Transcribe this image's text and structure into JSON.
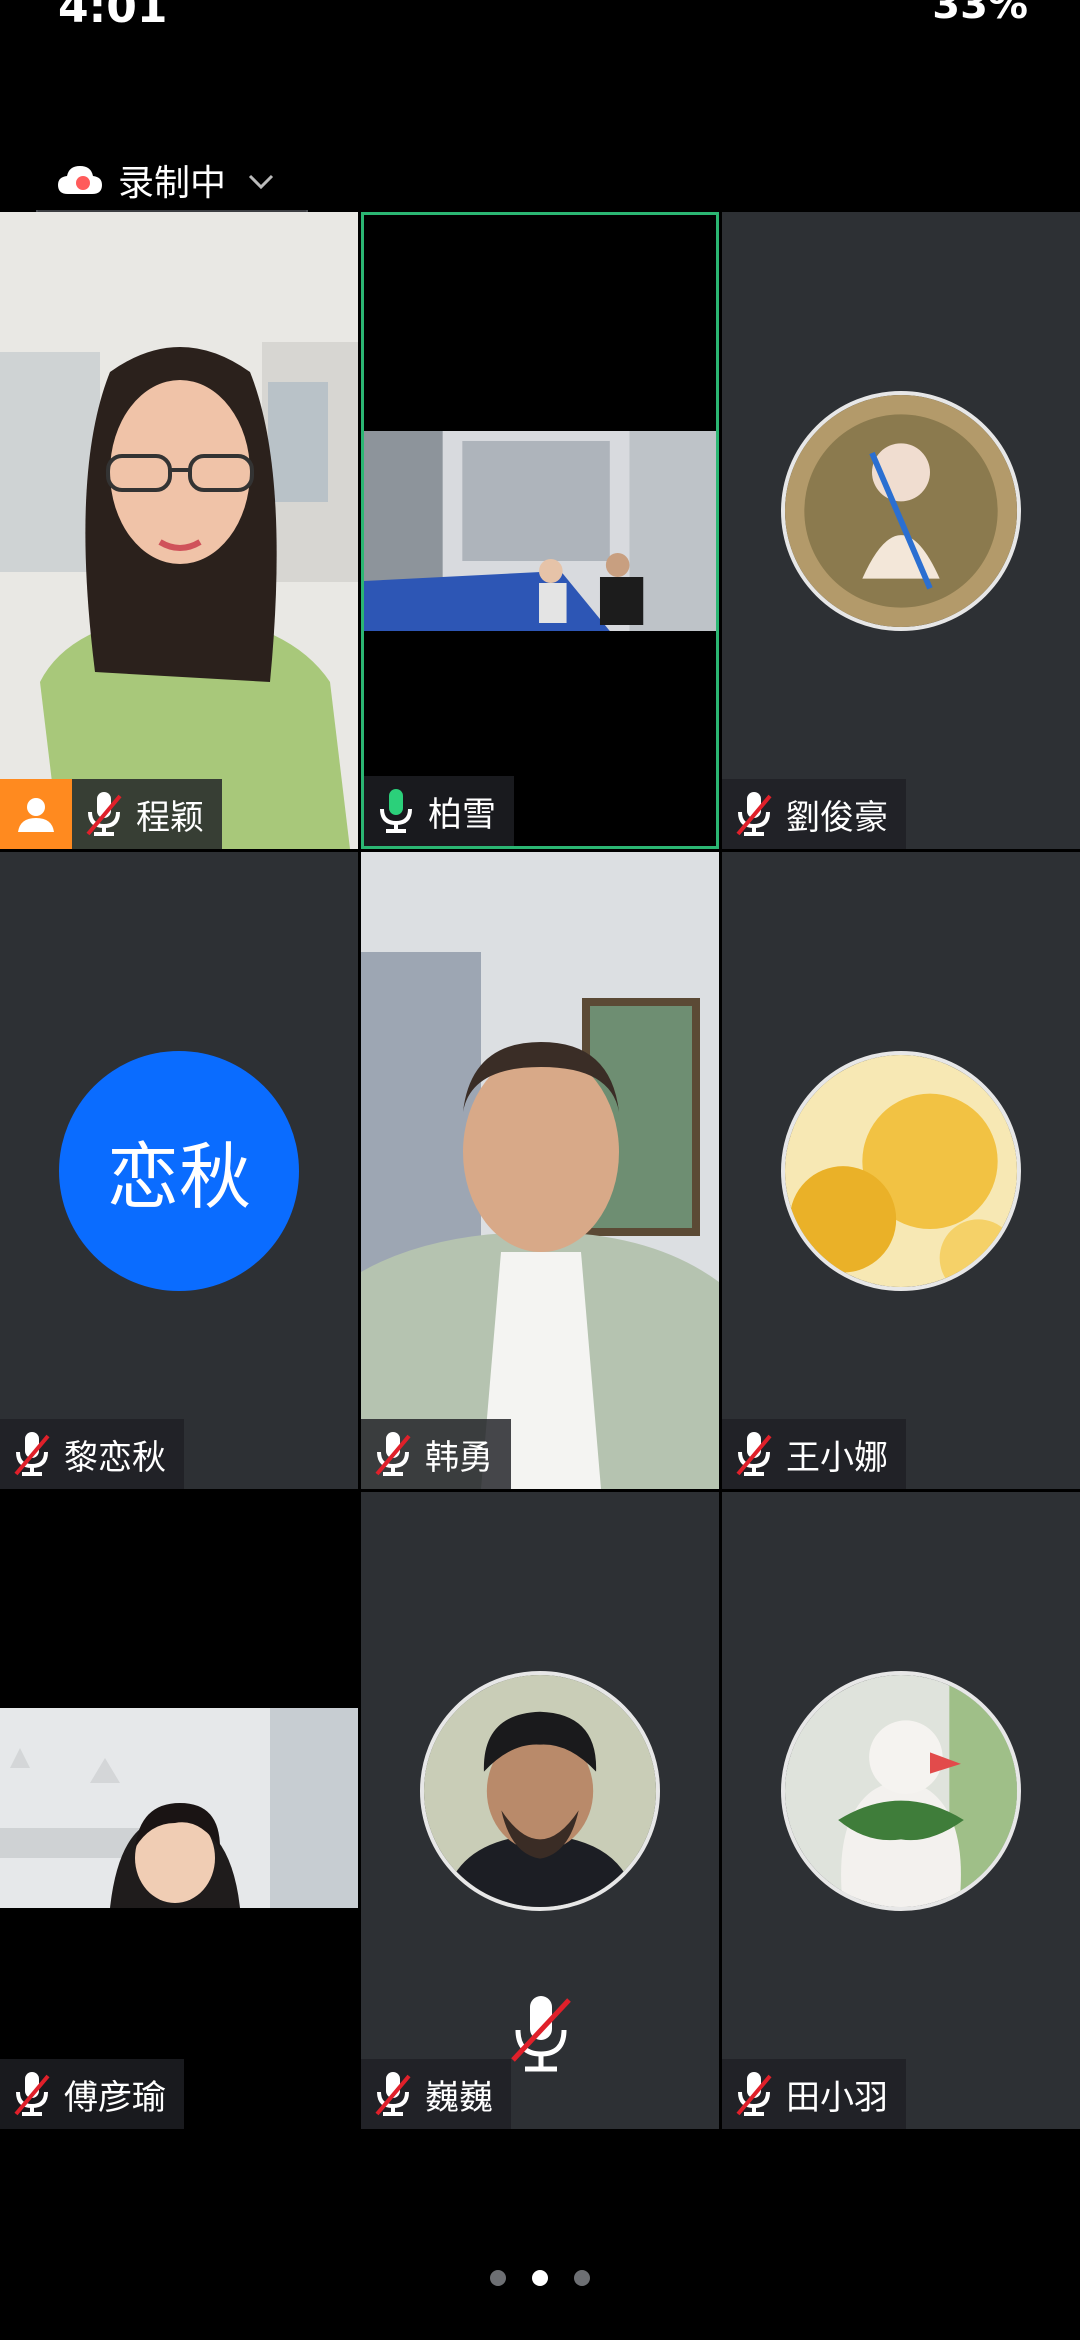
{
  "status_bar": {
    "time": "4:01",
    "battery": "33%"
  },
  "recording": {
    "label": "录制中"
  },
  "tiles": [
    {
      "name": "程颖",
      "muted": true,
      "host": true
    },
    {
      "name": "柏雪",
      "muted": false,
      "host": false
    },
    {
      "name": "劉俊豪",
      "muted": true,
      "host": false
    },
    {
      "name": "黎恋秋",
      "muted": true,
      "host": false,
      "avatar_text": "恋秋"
    },
    {
      "name": "韩勇",
      "muted": true,
      "host": false
    },
    {
      "name": "王小娜",
      "muted": true,
      "host": false
    },
    {
      "name": "傅彦瑜",
      "muted": true,
      "host": false
    },
    {
      "name": "巍巍",
      "muted": true,
      "host": false
    },
    {
      "name": "田小羽",
      "muted": true,
      "host": false
    }
  ],
  "pager": {
    "pages": 3,
    "current": 2
  },
  "colors": {
    "active_border": "#2bb673",
    "host_badge": "#ff8a1f",
    "text_avatar": "#0a6cff",
    "tile_bg": "#2d3034"
  }
}
